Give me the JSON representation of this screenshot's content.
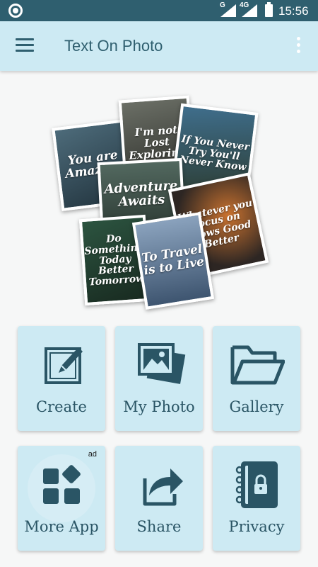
{
  "status_bar": {
    "time": "15:56",
    "network_1": "G",
    "network_2": "4G"
  },
  "app_bar": {
    "title": "Text On Photo",
    "menu_icon": "hamburger-menu-icon",
    "overflow_icon": "more-vert-icon"
  },
  "collage": {
    "cards": [
      {
        "text": "You are Amazing"
      },
      {
        "text": "I'm not Lost Exploring"
      },
      {
        "text": "If You Never Try You'll Never Know"
      },
      {
        "text": "Adventure Awaits"
      },
      {
        "text": "Whatever you focus on grows Good Better"
      },
      {
        "text": "Do Something Today Better Tomorrow"
      },
      {
        "text": "To Travel is to Live"
      }
    ]
  },
  "buttons": {
    "create": {
      "label": "Create",
      "icon": "edit-frame-icon"
    },
    "my_photo": {
      "label": "My Photo",
      "icon": "photo-stack-icon"
    },
    "gallery": {
      "label": "Gallery",
      "icon": "folder-open-icon"
    },
    "more_app": {
      "label": "More App",
      "icon": "apps-grid-icon",
      "badge": "ad"
    },
    "share": {
      "label": "Share",
      "icon": "share-icon"
    },
    "privacy": {
      "label": "Privacy",
      "icon": "lock-notebook-icon"
    }
  },
  "colors": {
    "status_bar": "#2f5f6f",
    "app_bar": "#cdeaf3",
    "accent": "#2f5f6f",
    "button_bg": "#cdeaf3",
    "background": "#f6f7f7"
  }
}
